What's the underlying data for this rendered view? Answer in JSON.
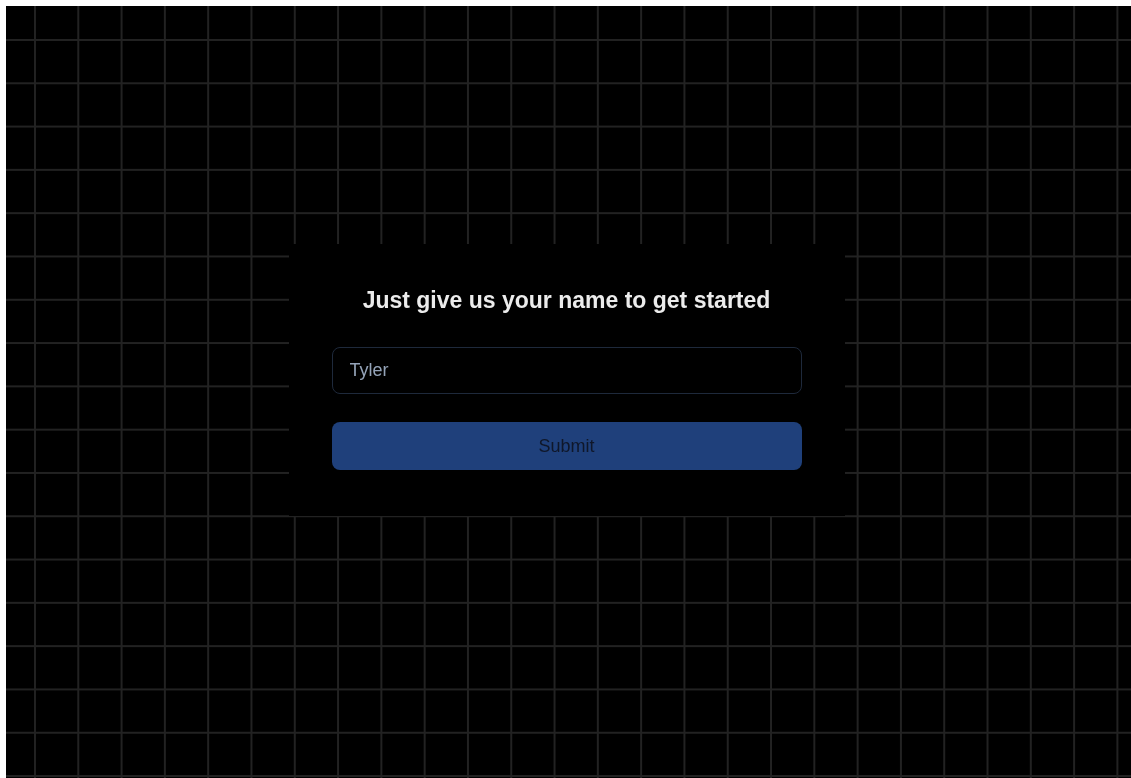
{
  "heading": "Just give us your name to get started",
  "name_field": {
    "placeholder": "Tyler"
  },
  "submit_button": {
    "label": "Submit"
  }
}
